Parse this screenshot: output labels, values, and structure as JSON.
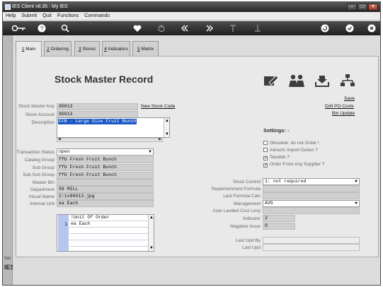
{
  "window": {
    "title": "IES Client v8.35 : My IES",
    "min": "–",
    "max": "□",
    "close": "✕"
  },
  "menu": [
    "Help",
    "Submit",
    "Quit",
    "Functions",
    "Commands"
  ],
  "toolbar_icons": [
    "key-icon",
    "help-icon",
    "search-icon",
    "heart-icon",
    "power-icon",
    "rewind-icon",
    "fast-forward-icon",
    "upload-icon",
    "download-icon",
    "refresh-icon",
    "check-icon",
    "close-icon"
  ],
  "tabs": [
    {
      "label": "1 Main",
      "accel": "1",
      "rest": " Main",
      "active": true
    },
    {
      "label": "2 Ordering",
      "accel": "2",
      "rest": " Ordering"
    },
    {
      "label": "3 Stores",
      "accel": "3",
      "rest": " Stores"
    },
    {
      "label": "4 Indicators",
      "accel": "4",
      "rest": " Indicators"
    },
    {
      "label": "5 Matrix",
      "accel": "5",
      "rest": " Matrix"
    }
  ],
  "header": {
    "title": "Stock Master Record"
  },
  "links": {
    "new_stock_code": "New Stock Code",
    "save": "Save",
    "drill_po_costs": "Drill PO Costs",
    "bin_update": "Bin Update"
  },
  "left_fields": {
    "stock_master_key": {
      "label": "Stock Master Key",
      "value": "90013"
    },
    "stock_account": {
      "label": "Stock Account",
      "value": "90013"
    },
    "description": {
      "label": "Description",
      "value": "FFB - Large Size Fruit Bunch"
    },
    "transaction_status": {
      "label": "Transaction Status",
      "value": "open"
    },
    "catalog_group": {
      "label": "Catalog Group",
      "value": "ffb Fresh Fruit Bunch"
    },
    "sub_group": {
      "label": "Sub Group",
      "value": "ffb Fresh Fruit Bunch"
    },
    "sub_sub_group": {
      "label": "Sub Sub Group",
      "value": "ffb Fresh Fruit Bunch"
    },
    "master_bin": {
      "label": "Master Bin",
      "value": ""
    },
    "department": {
      "label": "Department",
      "value": "99 MILL"
    },
    "visual_name": {
      "label": "Visual Name",
      "value": "2:iv90013.jpg"
    },
    "internal_unit": {
      "label": "Internal Unit",
      "value": "ea Each"
    }
  },
  "unit_of_order": {
    "header": "!Unit Of Order",
    "rows": [
      {
        "num": "1",
        "value": "ea Each"
      }
    ]
  },
  "settings": {
    "title": "Settings: -",
    "checks": [
      {
        "label": "Obsolete, do not Order !",
        "checked": false
      },
      {
        "label": "Attracts Import Duties ?",
        "checked": false
      },
      {
        "label": "Taxable ?",
        "checked": true
      },
      {
        "label": "Order From Any Supplier ?",
        "checked": true
      }
    ]
  },
  "right_fields": {
    "stock_control": {
      "label": "Stock Control",
      "value": "1: not required"
    },
    "replenishment_formula": {
      "label": "Replenishment Formula",
      "value": ""
    },
    "last_formula_calc": {
      "label": "Last Formula Calc",
      "value": ""
    },
    "management": {
      "label": "Management",
      "value": "AVG"
    },
    "auto_landed_cost_levy": {
      "label": "Auto Landed Cost Levy",
      "value": ""
    },
    "indicator": {
      "label": "Indicator",
      "value": "2"
    },
    "negative_issue": {
      "label": "Negative Issue",
      "value": "0"
    },
    "last_upd_by": {
      "label": "Last Upd By",
      "value": ""
    },
    "last_upd": {
      "label": "Last Upd",
      "value": ""
    }
  },
  "sidebar": {
    "sel_text": "Sel",
    "logo": "IES"
  }
}
